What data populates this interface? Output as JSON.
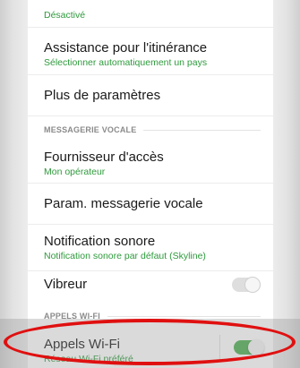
{
  "top_partial": {
    "subtitle": "Désactivé"
  },
  "roaming": {
    "title": "Assistance pour l'itinérance",
    "subtitle": "Sélectionner automatiquement un pays"
  },
  "more_settings": {
    "title": "Plus de paramètres"
  },
  "voicemail_section": {
    "header": "MESSAGERIE VOCALE"
  },
  "provider": {
    "title": "Fournisseur d'accès",
    "subtitle": "Mon opérateur"
  },
  "voicemail_settings": {
    "title": "Param. messagerie vocale"
  },
  "sound_notification": {
    "title": "Notification sonore",
    "subtitle": "Notification sonore par défaut (Skyline)"
  },
  "vibrate": {
    "title": "Vibreur",
    "state": "off"
  },
  "wifi_section": {
    "header": "APPELS WI-FI"
  },
  "wifi_calling": {
    "title": "Appels Wi-Fi",
    "subtitle": "Réseau Wi-Fi préféré",
    "state": "on"
  },
  "colors": {
    "accent_green": "#2e9a3c",
    "toggle_on": "#4caf50",
    "highlight_red": "#e01010"
  }
}
